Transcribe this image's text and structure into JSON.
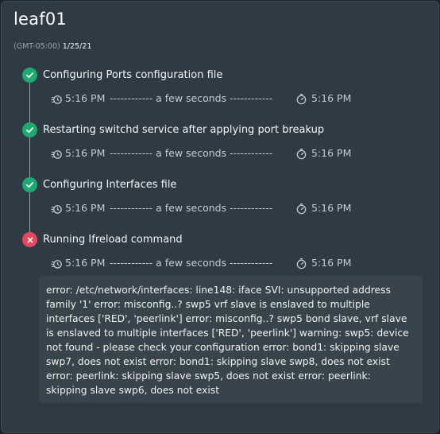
{
  "header": {
    "title": "leaf01",
    "timezone": "(GMT-05:00)",
    "date": "1/25/21"
  },
  "steps": [
    {
      "label": "Configuring Ports configuration file",
      "status": "success",
      "start": "5:16 PM",
      "duration": "------------ a few seconds ------------",
      "end": "5:16 PM"
    },
    {
      "label": "Restarting switchd service after applying port breakup",
      "status": "success",
      "start": "5:16 PM",
      "duration": "------------ a few seconds ------------",
      "end": "5:16 PM"
    },
    {
      "label": "Configuring Interfaces file",
      "status": "success",
      "start": "5:16 PM",
      "duration": "------------ a few seconds ------------",
      "end": "5:16 PM"
    },
    {
      "label": "Running Ifreload command",
      "status": "failed",
      "start": "5:16 PM",
      "duration": "------------ a few seconds ------------",
      "end": "5:16 PM"
    }
  ],
  "error": {
    "message": "error: /etc/network/interfaces: line148: iface SVI: unsupported address family '1' error: misconfig..? swp5 vrf slave is enslaved to multiple interfaces ['RED', 'peerlink'] error: misconfig..? swp5 bond slave, vrf slave is enslaved to multiple interfaces ['RED', 'peerlink'] warning: swp5: device not found - please check your configuration error: bond1: skipping slave swp7, does not exist error: bond1: skipping slave swp8, does not exist error: peerlink: skipping slave swp5, does not exist error: peerlink: skipping slave swp6, does not exist"
  },
  "icons": {
    "success": "check-circle-icon",
    "failed": "x-circle-icon",
    "start": "start-timer-icon",
    "end": "stopwatch-icon"
  },
  "colors": {
    "panel_bg": "#2f3b44",
    "success": "#1fa971",
    "failed": "#e5485d",
    "error_box_bg": "#38444c"
  }
}
